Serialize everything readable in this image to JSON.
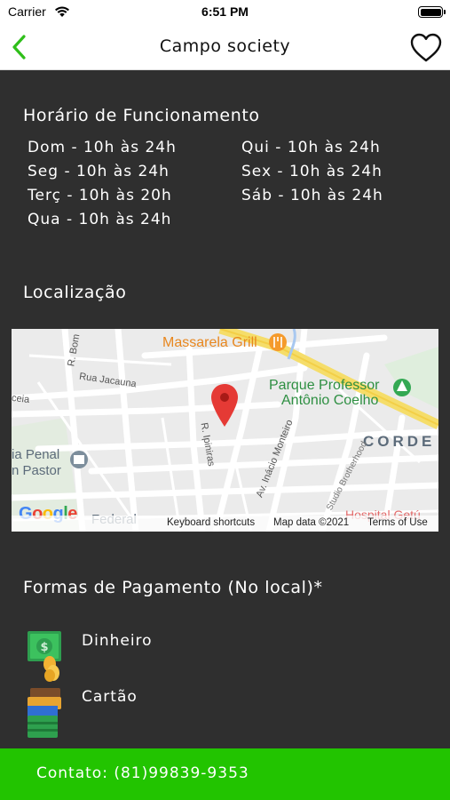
{
  "status_bar": {
    "carrier": "Carrier",
    "time": "6:51 PM"
  },
  "nav": {
    "title": "Campo society",
    "back_icon": "chevron-left-icon",
    "favorite_icon": "heart-outline-icon",
    "accent_color": "#2fbf1a"
  },
  "hours": {
    "title": "Horário de Funcionamento",
    "left": [
      "Dom - 10h às 24h",
      "Seg - 10h às 24h",
      "Terç - 10h às 20h",
      "Qua - 10h às 24h"
    ],
    "right": [
      "Qui - 10h às 24h",
      "Sex - 10h às 24h",
      "Sáb - 10h às 24h"
    ]
  },
  "location": {
    "title": "Localização",
    "map": {
      "places": [
        "Massarela Grill",
        "Parque Professor",
        "Antônio Coelho",
        "CORDE",
        "ia Penal",
        "n Pastor",
        "Federal",
        "Hospital Getú"
      ],
      "streets": [
        "R. Bom",
        "Rua Jacauna",
        "ceia",
        "R. Ipiniras",
        "Av. Inácio Monteiro",
        "Studio Brotherhood"
      ],
      "logo": "Google",
      "footer": {
        "shortcuts": "Keyboard shortcuts",
        "data": "Map data ©2021",
        "terms": "Terms of Use"
      }
    }
  },
  "payment": {
    "title": "Formas de Pagamento (No local)*",
    "methods": [
      {
        "label": "Dinheiro",
        "icon": "cash-coins-icon"
      },
      {
        "label": "Cartão",
        "icon": "wallet-cards-icon"
      }
    ]
  },
  "contact": {
    "label": "Contato: (81)99839-9353",
    "color": "#22c400"
  }
}
